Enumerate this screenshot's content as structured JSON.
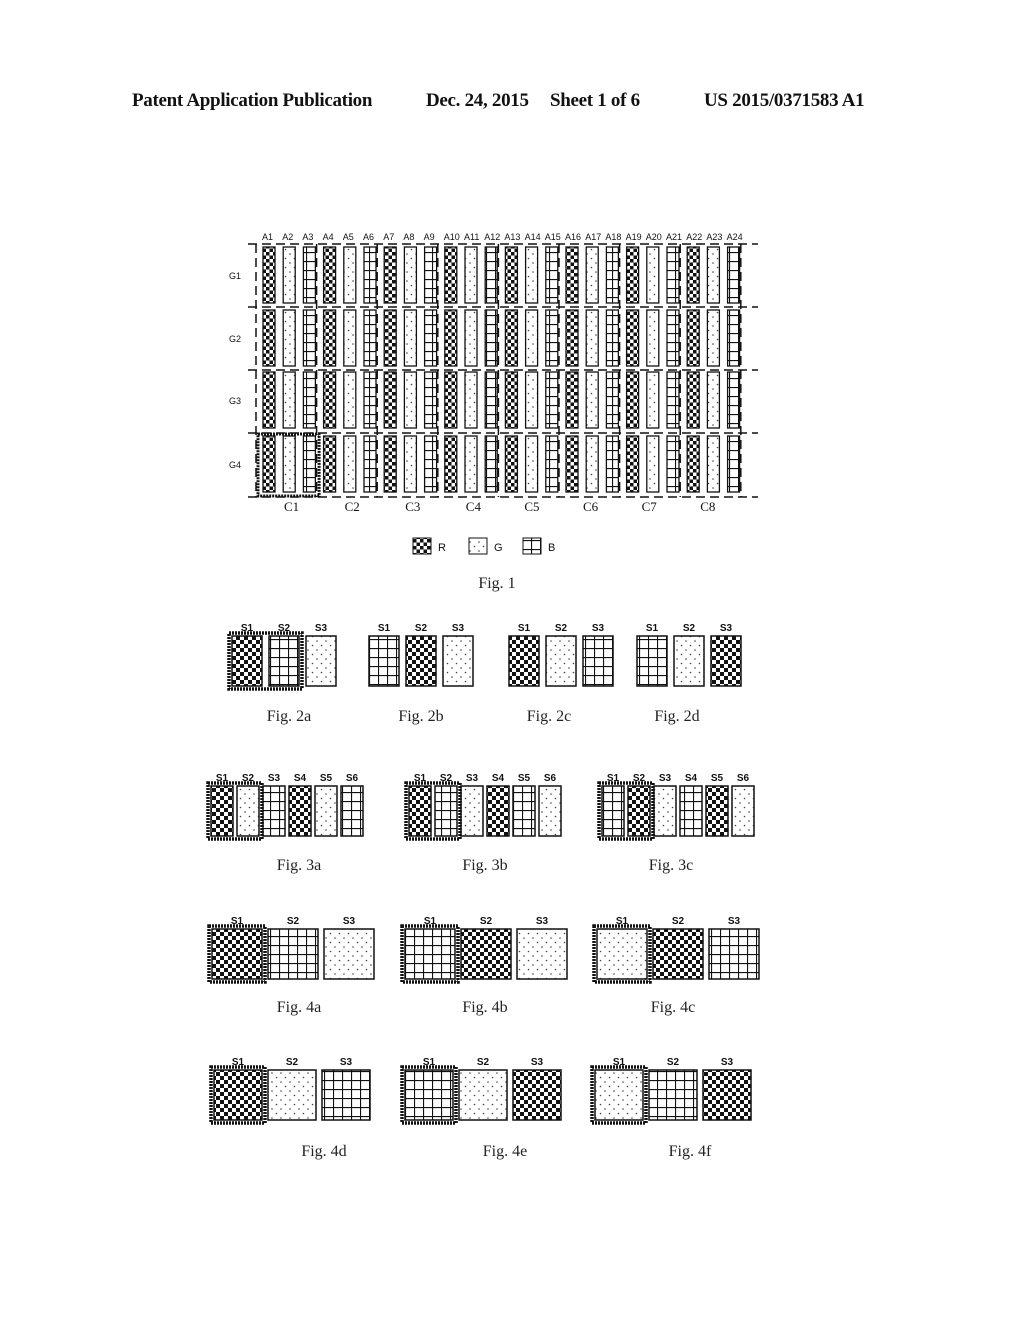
{
  "header": {
    "publication": "Patent Application Publication",
    "date": "Dec. 24, 2015",
    "sheet": "Sheet 1 of 6",
    "number": "US 2015/0371583 A1"
  },
  "patterns": {
    "R": "checker",
    "G": "dots",
    "B": "grid"
  },
  "fig1": {
    "caption": "Fig. 1",
    "column_labels": [
      "A1",
      "A2",
      "A3",
      "A4",
      "A5",
      "A6",
      "A7",
      "A8",
      "A9",
      "A10",
      "A11",
      "A12",
      "A13",
      "A14",
      "A15",
      "A16",
      "A17",
      "A18",
      "A19",
      "A20",
      "A21",
      "A22",
      "A23",
      "A24"
    ],
    "row_labels": [
      "G1",
      "G2",
      "G3",
      "G4"
    ],
    "group_labels": [
      "C1",
      "C2",
      "C3",
      "C4",
      "C5",
      "C6",
      "C7",
      "C8"
    ],
    "column_colors": [
      "R",
      "G",
      "B",
      "R",
      "G",
      "B",
      "R",
      "G",
      "B",
      "R",
      "G",
      "B",
      "R",
      "G",
      "B",
      "R",
      "G",
      "B",
      "R",
      "G",
      "B",
      "R",
      "G",
      "B"
    ],
    "highlighted": {
      "row": "G4",
      "group": "C1"
    },
    "legend": [
      {
        "key": "R",
        "label": "R"
      },
      {
        "key": "G",
        "label": "G"
      },
      {
        "key": "B",
        "label": "B"
      }
    ]
  },
  "figs_row2": [
    {
      "caption": "Fig. 2a",
      "labels": [
        "S1",
        "S2",
        "S3"
      ],
      "colors": [
        "R",
        "B",
        "G"
      ],
      "highlight": [
        0,
        1
      ]
    },
    {
      "caption": "Fig. 2b",
      "labels": [
        "S1",
        "S2",
        "S3"
      ],
      "colors": [
        "B",
        "R",
        "G"
      ],
      "highlight": []
    },
    {
      "caption": "Fig. 2c",
      "labels": [
        "S1",
        "S2",
        "S3"
      ],
      "colors": [
        "R",
        "G",
        "B"
      ],
      "highlight": []
    },
    {
      "caption": "Fig. 2d",
      "labels": [
        "S1",
        "S2",
        "S3"
      ],
      "colors": [
        "B",
        "G",
        "R"
      ],
      "highlight": []
    }
  ],
  "figs_row3": [
    {
      "caption": "Fig. 3a",
      "labels": [
        "S1",
        "S2",
        "S3",
        "S4",
        "S5",
        "S6"
      ],
      "colors": [
        "R",
        "G",
        "B",
        "R",
        "G",
        "B"
      ],
      "highlight": [
        0,
        1
      ]
    },
    {
      "caption": "Fig. 3b",
      "labels": [
        "S1",
        "S2",
        "S3",
        "S4",
        "S5",
        "S6"
      ],
      "colors": [
        "R",
        "B",
        "G",
        "R",
        "B",
        "G"
      ],
      "highlight": [
        0,
        1
      ]
    },
    {
      "caption": "Fig. 3c",
      "labels": [
        "S1",
        "S2",
        "S3",
        "S4",
        "S5",
        "S6"
      ],
      "colors": [
        "B",
        "R",
        "G",
        "B",
        "R",
        "G"
      ],
      "highlight": [
        0,
        1
      ]
    }
  ],
  "figs_row4": [
    {
      "caption": "Fig. 4a",
      "labels": [
        "S1",
        "S2",
        "S3"
      ],
      "colors": [
        "R",
        "B",
        "G"
      ],
      "highlight": [
        0
      ]
    },
    {
      "caption": "Fig. 4b",
      "labels": [
        "S1",
        "S2",
        "S3"
      ],
      "colors": [
        "B",
        "R",
        "G"
      ],
      "highlight": [
        0
      ]
    },
    {
      "caption": "Fig. 4c",
      "labels": [
        "S1",
        "S2",
        "S3"
      ],
      "colors": [
        "G",
        "R",
        "B"
      ],
      "highlight": [
        0
      ]
    }
  ],
  "figs_row5": [
    {
      "caption": "Fig. 4d",
      "labels": [
        "S1",
        "S2",
        "S3"
      ],
      "colors": [
        "R",
        "G",
        "B"
      ],
      "highlight": [
        0
      ]
    },
    {
      "caption": "Fig. 4e",
      "labels": [
        "S1",
        "S2",
        "S3"
      ],
      "colors": [
        "B",
        "G",
        "R"
      ],
      "highlight": [
        0
      ]
    },
    {
      "caption": "Fig. 4f",
      "labels": [
        "S1",
        "S2",
        "S3"
      ],
      "colors": [
        "G",
        "B",
        "R"
      ],
      "highlight": [
        0
      ]
    }
  ]
}
